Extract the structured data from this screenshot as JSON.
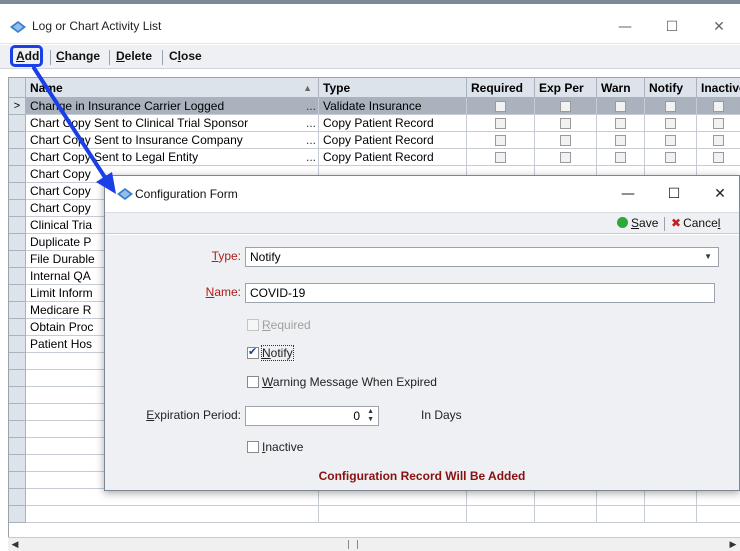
{
  "window": {
    "title": "Log or Chart Activity List",
    "minimize": "—",
    "maximize": "☐",
    "close": "✕"
  },
  "menu": {
    "add_u": "A",
    "add_rest": "dd",
    "change_u": "C",
    "change_rest": "hange",
    "delete_u": "D",
    "delete_rest": "elete",
    "close_a": "C",
    "close_u": "l",
    "close_rest": "ose"
  },
  "grid": {
    "columns": [
      "Name",
      "Type",
      "Required",
      "Exp Per",
      "Warn",
      "Notify",
      "Inactive"
    ],
    "sort_indicator": "▲",
    "selected_row_marker": ">",
    "ellipsis": "...",
    "rows": [
      {
        "name": "Change in Insurance Carrier Logged",
        "type": "Validate Insurance"
      },
      {
        "name": "Chart Copy Sent to Clinical Trial Sponsor",
        "type": "Copy Patient Record"
      },
      {
        "name": "Chart Copy Sent to Insurance Company",
        "type": "Copy Patient Record"
      },
      {
        "name": "Chart Copy Sent to Legal Entity",
        "type": "Copy Patient Record"
      },
      {
        "name": "Chart Copy",
        "type": ""
      },
      {
        "name": "Chart Copy",
        "type": ""
      },
      {
        "name": "Chart Copy",
        "type": ""
      },
      {
        "name": "Clinical Tria",
        "type": ""
      },
      {
        "name": "Duplicate P",
        "type": ""
      },
      {
        "name": "File Durable",
        "type": ""
      },
      {
        "name": "Internal QA",
        "type": ""
      },
      {
        "name": "Limit Inform",
        "type": ""
      },
      {
        "name": "Medicare R",
        "type": ""
      },
      {
        "name": "Obtain Proc",
        "type": ""
      },
      {
        "name": "Patient Hos",
        "type": ""
      }
    ]
  },
  "dialog": {
    "title": "Configuration Form",
    "minimize": "—",
    "maximize": "☐",
    "close": "✕",
    "save_u": "S",
    "save_rest": "ave",
    "cancel_a": "Cance",
    "cancel_u": "l",
    "type_label_u": "T",
    "type_label_rest": "ype:",
    "type_value": "Notify",
    "name_label_u": "N",
    "name_label_rest": "ame:",
    "name_value": "COVID-19",
    "required_u": "R",
    "required_rest": "equired",
    "notify_u": "N",
    "notify_rest": "otify",
    "warning_u": "W",
    "warning_rest": "arning Message When Expired",
    "exp_label_u": "E",
    "exp_label_rest": "xpiration Period:",
    "exp_value": "0",
    "exp_unit": "In Days",
    "inactive_u": "I",
    "inactive_rest": "nactive",
    "status": "Configuration Record Will Be Added",
    "notify_checked": "✔"
  },
  "scrollbar": {
    "left": "◀",
    "right": "▶"
  },
  "colors": {
    "accent_annotation": "#1a3fe6",
    "save_green": "#2fa83a",
    "cancel_red": "#c81e1e",
    "status_text": "#8a1010"
  }
}
